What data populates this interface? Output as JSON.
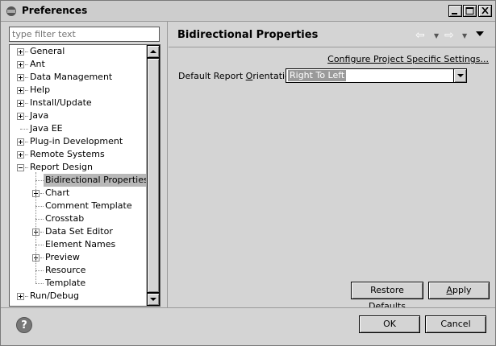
{
  "window": {
    "title": "Preferences",
    "icon": "eclipse-icon"
  },
  "filter": {
    "placeholder": "type filter text"
  },
  "tree": {
    "items": [
      {
        "label": "General",
        "level": 0,
        "expander": "plus"
      },
      {
        "label": "Ant",
        "level": 0,
        "expander": "plus"
      },
      {
        "label": "Data Management",
        "level": 0,
        "expander": "plus"
      },
      {
        "label": "Help",
        "level": 0,
        "expander": "plus"
      },
      {
        "label": "Install/Update",
        "level": 0,
        "expander": "plus"
      },
      {
        "label": "Java",
        "level": 0,
        "expander": "plus"
      },
      {
        "label": "Java EE",
        "level": 0,
        "expander": "none"
      },
      {
        "label": "Plug-in Development",
        "level": 0,
        "expander": "plus"
      },
      {
        "label": "Remote Systems",
        "level": 0,
        "expander": "plus"
      },
      {
        "label": "Report Design",
        "level": 0,
        "expander": "minus"
      },
      {
        "label": "Bidirectional Properties",
        "level": 1,
        "expander": "none",
        "selected": true
      },
      {
        "label": "Chart",
        "level": 1,
        "expander": "plus"
      },
      {
        "label": "Comment Template",
        "level": 1,
        "expander": "none"
      },
      {
        "label": "Crosstab",
        "level": 1,
        "expander": "none"
      },
      {
        "label": "Data Set Editor",
        "level": 1,
        "expander": "plus"
      },
      {
        "label": "Element Names",
        "level": 1,
        "expander": "none"
      },
      {
        "label": "Preview",
        "level": 1,
        "expander": "plus"
      },
      {
        "label": "Resource",
        "level": 1,
        "expander": "none"
      },
      {
        "label": "Template",
        "level": 1,
        "expander": "none"
      },
      {
        "label": "Run/Debug",
        "level": 0,
        "expander": "plus"
      }
    ]
  },
  "page": {
    "title": "Bidirectional Properties",
    "config_link": "Configure Project Specific Settings...",
    "orientation_label": "Default Report Orientation:",
    "orientation_value": "Right To Left"
  },
  "buttons": {
    "restore_defaults": "Restore Defaults",
    "apply": "Apply",
    "ok": "OK",
    "cancel": "Cancel",
    "help": "?"
  },
  "nav": {
    "back": "⇦",
    "forward": "⇨"
  }
}
